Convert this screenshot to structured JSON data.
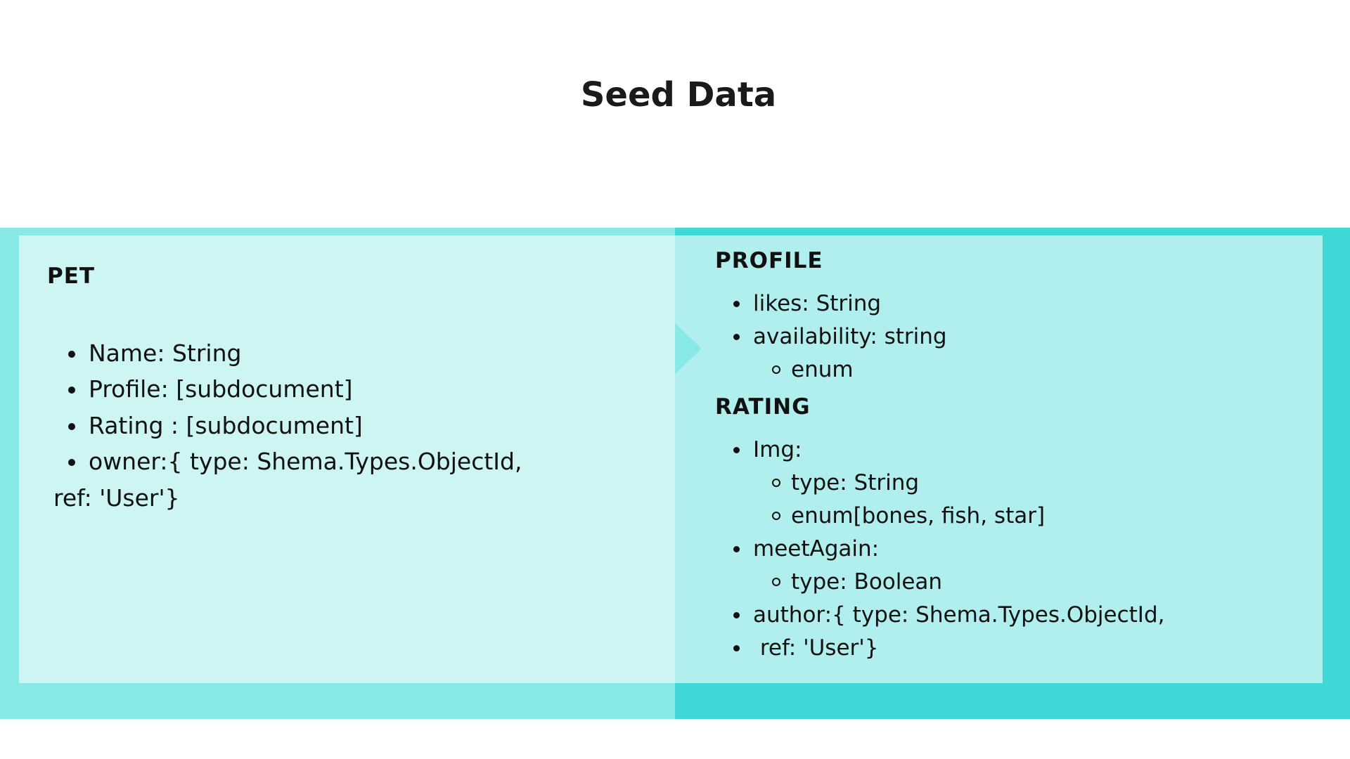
{
  "title": "Seed Data",
  "colors": {
    "band_left": "#88e9e7",
    "band_right": "#3fd8d6",
    "panel_left": "#ccf5f4",
    "panel_right": "#b1efee"
  },
  "pet": {
    "heading": "PET",
    "items": [
      "Name: String",
      "Profile: [subdocument]",
      "Rating : [subdocument]",
      "owner:{ type: Shema.Types.ObjectId,"
    ],
    "continuation": "ref: 'User'}"
  },
  "profile": {
    "heading": "PROFILE",
    "items": [
      "likes: String",
      "availability: string"
    ],
    "subitems": [
      "enum"
    ]
  },
  "rating": {
    "heading": "RATING",
    "img": "Img:",
    "img_sub": [
      "type: String",
      "enum[bones, fish, star]"
    ],
    "meet": "meetAgain:",
    "meet_sub": [
      "type: Boolean"
    ],
    "author": "author:{ type: Shema.Types.ObjectId,",
    "ref": " ref: 'User'}"
  }
}
